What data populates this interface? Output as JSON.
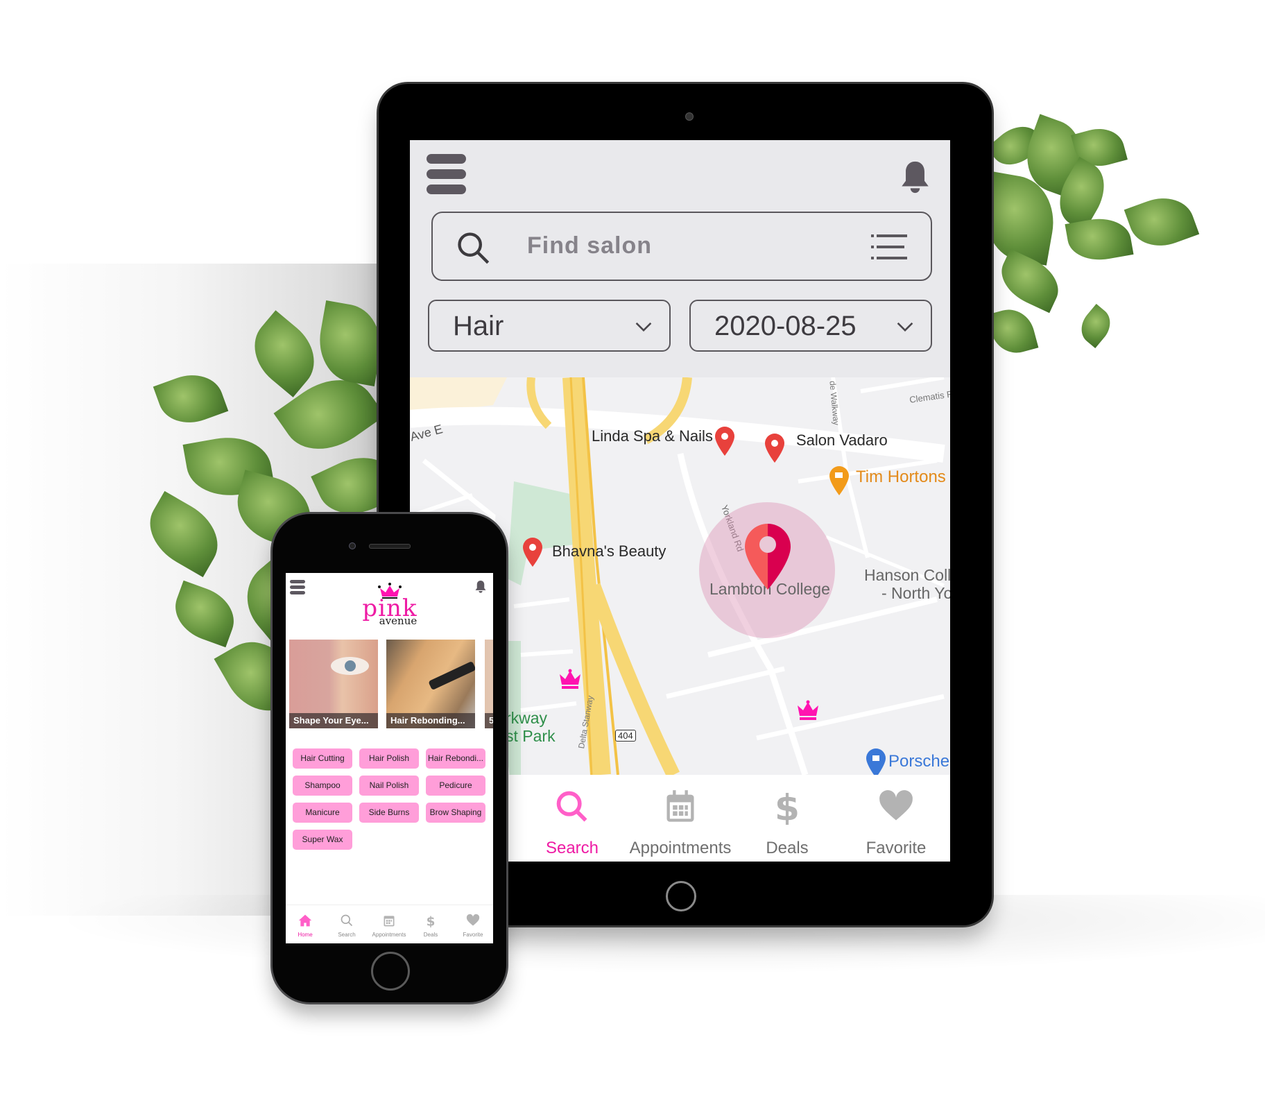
{
  "tablet": {
    "header": {
      "menu_icon": "hamburger-icon",
      "bell_icon": "bell-icon"
    },
    "search": {
      "placeholder": "Find salon",
      "search_icon": "search-icon",
      "filter_icon": "list-icon"
    },
    "filters": {
      "category": "Hair",
      "date": "2020-08-25"
    },
    "map": {
      "labels": [
        {
          "text": "Ave E",
          "kind": "street"
        },
        {
          "text": "Linda Spa & Nails",
          "kind": "salon"
        },
        {
          "text": "Salon Vadaro",
          "kind": "salon"
        },
        {
          "text": "Tim Hortons",
          "kind": "cafe"
        },
        {
          "text": "Bhavna's Beauty",
          "kind": "salon"
        },
        {
          "text": "Lambton College",
          "kind": "place"
        },
        {
          "text": "Hanson Coll",
          "kind": "place"
        },
        {
          "text": "- North Yo",
          "kind": "place"
        },
        {
          "text": "rkway",
          "kind": "park"
        },
        {
          "text": "st Park",
          "kind": "park"
        },
        {
          "text": "Porsche",
          "kind": "shop"
        },
        {
          "text": "404",
          "kind": "highway"
        },
        {
          "text": "Yorkland Rd",
          "kind": "street"
        },
        {
          "text": "Clematis Rd",
          "kind": "street"
        },
        {
          "text": "Delta Stanway",
          "kind": "street"
        },
        {
          "text": "de Walkway",
          "kind": "street"
        }
      ]
    },
    "nav": [
      {
        "label": "Search",
        "icon": "search-icon",
        "active": true
      },
      {
        "label": "Appointments",
        "icon": "calendar-icon",
        "active": false
      },
      {
        "label": "Deals",
        "icon": "dollar-icon",
        "active": false
      },
      {
        "label": "Favorite",
        "icon": "heart-icon",
        "active": false
      }
    ]
  },
  "phone": {
    "logo": {
      "line1": "pink",
      "line2": "avenue"
    },
    "cards": [
      {
        "caption": "Shape Your Eye..."
      },
      {
        "caption": "Hair Rebonding..."
      },
      {
        "caption": "5"
      }
    ],
    "services": [
      "Hair Cutting",
      "Hair Polish",
      "Hair Rebondi...",
      "Shampoo",
      "Nail Polish",
      "Pedicure",
      "Manicure",
      "Side Burns",
      "Brow Shaping",
      "Super Wax"
    ],
    "nav": [
      {
        "label": "Home",
        "icon": "home-icon",
        "active": true
      },
      {
        "label": "Search",
        "icon": "search-icon",
        "active": false
      },
      {
        "label": "Appointments",
        "icon": "calendar-icon",
        "active": false
      },
      {
        "label": "Deals",
        "icon": "dollar-icon",
        "active": false
      },
      {
        "label": "Favorite",
        "icon": "heart-icon",
        "active": false
      }
    ]
  },
  "colors": {
    "accent": "#ee1ba4",
    "chip": "#ff9ed9",
    "pin": "#e8413c",
    "screen_bg": "#e9e9ec",
    "inactive": "#b3b3b3"
  }
}
